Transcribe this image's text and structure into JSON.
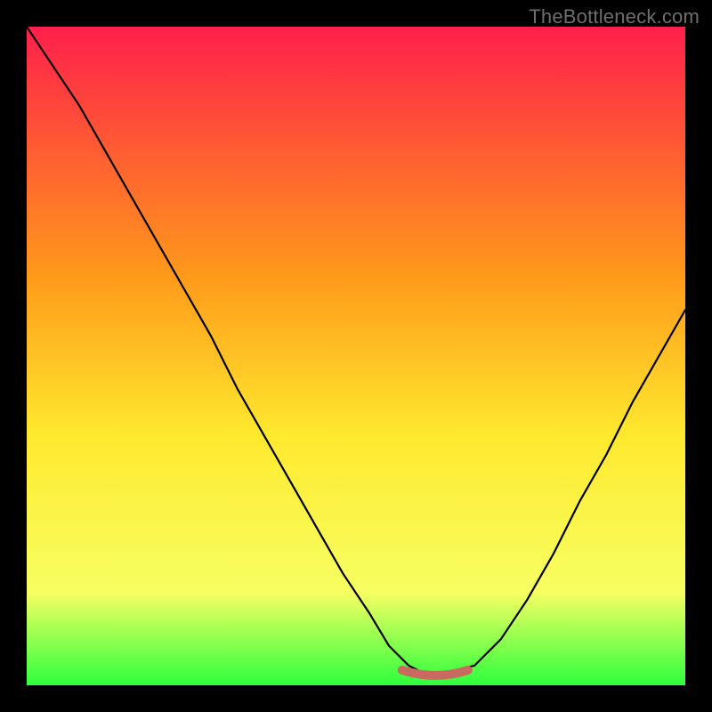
{
  "watermark": "TheBottleneck.com",
  "colors": {
    "frame": "#000000",
    "watermark": "#6e6e6e",
    "gradient_top": "#ff1f4b",
    "gradient_mid1": "#ff9a1a",
    "gradient_mid2": "#ffe92e",
    "gradient_mid3": "#f6ff62",
    "gradient_bottom": "#2dff3d",
    "curve": "#000000",
    "marker": "#c96a60"
  },
  "chart_data": {
    "type": "line",
    "title": "",
    "xlabel": "",
    "ylabel": "",
    "xlim": [
      0,
      100
    ],
    "ylim": [
      0,
      100
    ],
    "series": [
      {
        "name": "bottleneck-curve",
        "x": [
          0,
          4,
          8,
          12,
          16,
          20,
          24,
          28,
          32,
          36,
          40,
          44,
          48,
          52,
          55,
          58,
          60,
          62,
          64,
          68,
          72,
          76,
          80,
          84,
          88,
          92,
          96,
          100
        ],
        "values": [
          100,
          94,
          88,
          81,
          74,
          67,
          60,
          53,
          45,
          38,
          31,
          24,
          17,
          11,
          6,
          3,
          2,
          2,
          2,
          3,
          7,
          13,
          20,
          28,
          35,
          43,
          50,
          57
        ]
      }
    ],
    "annotations": [
      {
        "name": "optimal-range-marker",
        "x_start": 57,
        "x_end": 67,
        "y": 1.5
      }
    ]
  }
}
